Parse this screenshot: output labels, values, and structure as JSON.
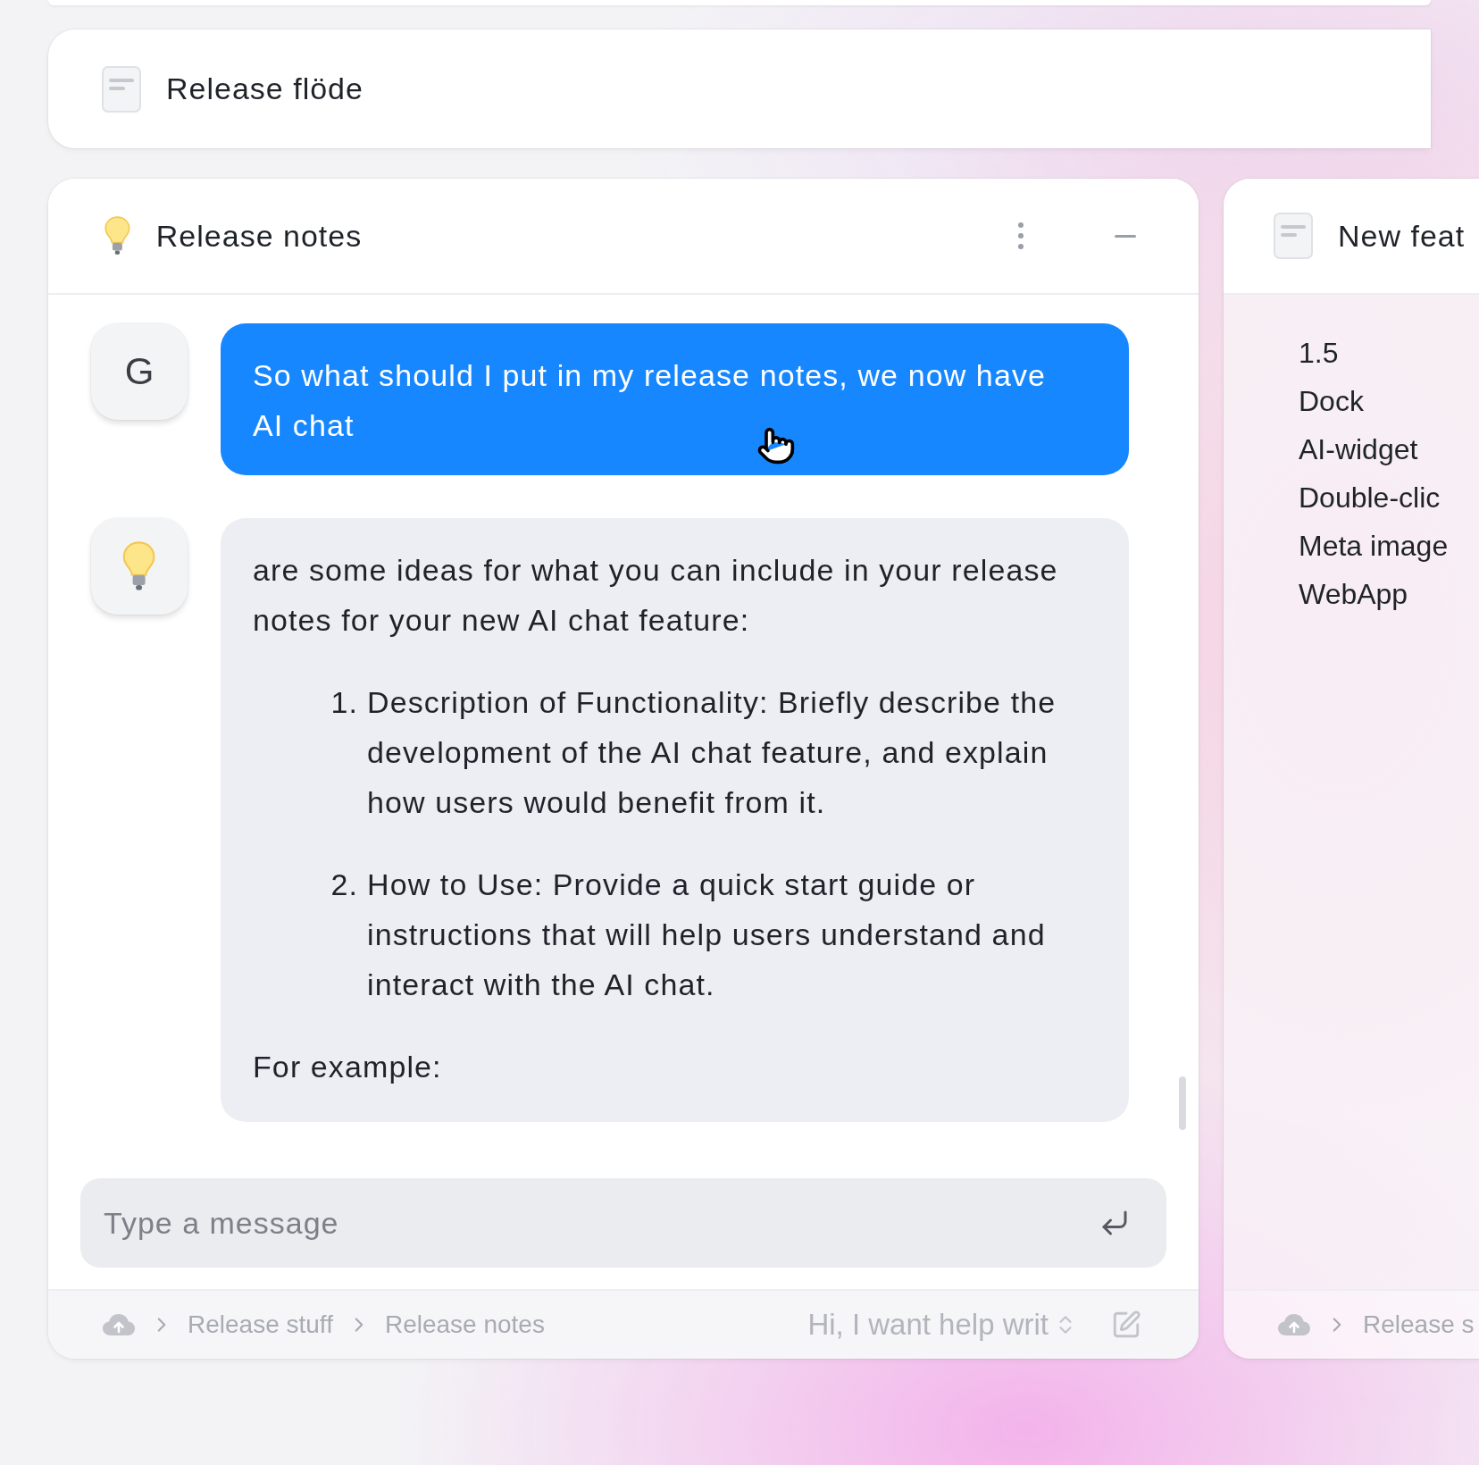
{
  "header": {
    "title": "Release flöde"
  },
  "chat_panel": {
    "title": "Release notes",
    "messages": [
      {
        "kind": "user",
        "avatar": "G",
        "text": "So what should I put in my release notes, we now have AI chat"
      },
      {
        "kind": "assistant",
        "intro": "are some ideas for what you can include in your release notes for your new AI chat feature:",
        "items": [
          {
            "number": "1.",
            "text": "Description of Functionality: Briefly describe the development of the AI chat feature, and explain how users would benefit from it."
          },
          {
            "number": "2.",
            "text": "How to Use: Provide a quick start guide or instructions that will help users understand and interact with the AI chat."
          }
        ],
        "outro": "For example:"
      }
    ],
    "input": {
      "placeholder": "Type a message"
    },
    "footer": {
      "breadcrumbs": [
        "Release stuff",
        "Release notes"
      ],
      "prompt": "Hi, I want help writ"
    }
  },
  "side_panel": {
    "title": "New feat",
    "lines": [
      "1.5",
      "Dock",
      "AI-widget",
      "Double-clic",
      "Meta image",
      "WebApp"
    ],
    "footer": {
      "breadcrumbs": [
        "Release s"
      ]
    }
  }
}
